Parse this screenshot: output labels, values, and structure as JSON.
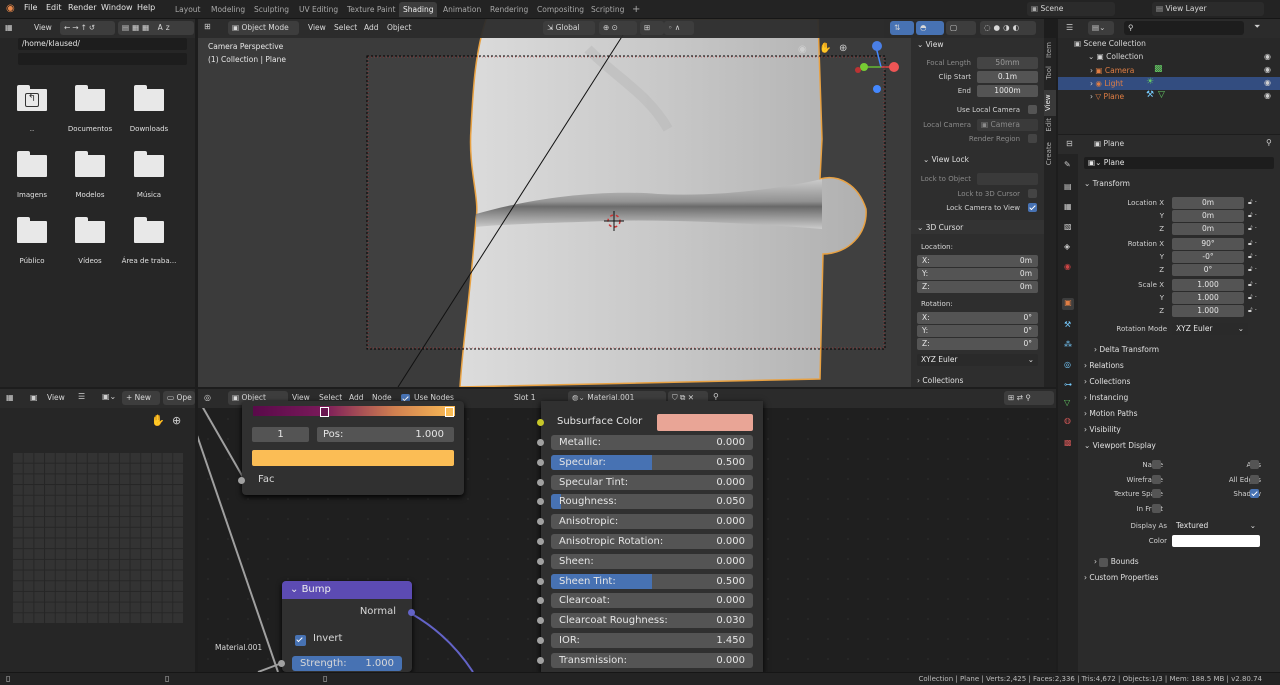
{
  "topbar": {
    "menus": [
      "File",
      "Edit",
      "Render",
      "Window",
      "Help"
    ],
    "tabs": [
      "Layout",
      "Modeling",
      "Sculpting",
      "UV Editing",
      "Texture Paint",
      "Shading",
      "Animation",
      "Rendering",
      "Compositing",
      "Scripting"
    ],
    "add_tab": "+",
    "scene": "Scene",
    "view_layer": "View Layer"
  },
  "file_browser": {
    "view_menu": "View",
    "path": "/home/klaused/",
    "folders": [
      {
        "label": "..",
        "icon": "parent-folder-icon"
      },
      {
        "label": "Documentos"
      },
      {
        "label": "Downloads"
      },
      {
        "label": "Imagens"
      },
      {
        "label": "Modelos"
      },
      {
        "label": "Música"
      },
      {
        "label": "Público"
      },
      {
        "label": "Vídeos"
      },
      {
        "label": "Área de traba..."
      }
    ]
  },
  "viewport": {
    "mode": "Object Mode",
    "menus": [
      "View",
      "Select",
      "Add",
      "Object"
    ],
    "orientation": "Global",
    "camera_label": "Camera Perspective",
    "collection_label": "(1) Collection | Plane"
  },
  "n_panel": {
    "tabs": [
      "Item",
      "Tool",
      "View",
      "Edit",
      "Create"
    ],
    "view_title": "View",
    "focal_length_label": "Focal Length",
    "focal_length": "50mm",
    "clip_start_label": "Clip Start",
    "clip_start": "0.1m",
    "end_label": "End",
    "clip_end": "1000m",
    "use_local_camera": "Use Local Camera",
    "local_camera_label": "Local Camera",
    "local_camera": "Camera",
    "render_region": "Render Region",
    "view_lock_title": "View Lock",
    "lock_to_object": "Lock to Object",
    "lock_to_3d_cursor": "Lock to 3D Cursor",
    "lock_camera_to_view": "Lock Camera to View",
    "cursor_title": "3D Cursor",
    "location_label": "Location:",
    "rotation_label": "Rotation:",
    "loc_x_label": "X:",
    "loc_x": "0m",
    "loc_y_label": "Y:",
    "loc_y": "0m",
    "loc_z_label": "Z:",
    "loc_z": "0m",
    "rot_x_label": "X:",
    "rot_x": "0°",
    "rot_y_label": "Y:",
    "rot_y": "0°",
    "rot_z_label": "Z:",
    "rot_z": "0°",
    "rot_mode": "XYZ Euler",
    "collections_title": "Collections"
  },
  "outliner": {
    "scene_collection": "Scene Collection",
    "collection": "Collection",
    "items": [
      {
        "label": "Camera",
        "color": "#e07e44"
      },
      {
        "label": "Light",
        "color": "#e07e44"
      },
      {
        "label": "Plane",
        "color": "#e07e44"
      }
    ]
  },
  "properties": {
    "object_name": "Plane",
    "data_name": "Plane",
    "transform_title": "Transform",
    "location_x_label": "Location X",
    "location_x": "0m",
    "location_y_label": "Y",
    "location_y": "0m",
    "location_z_label": "Z",
    "location_z": "0m",
    "rotation_x_label": "Rotation X",
    "rotation_x": "90°",
    "rotation_y_label": "Y",
    "rotation_y": "-0°",
    "rotation_z_label": "Z",
    "rotation_z": "0°",
    "scale_x_label": "Scale X",
    "scale_x": "1.000",
    "scale_y_label": "Y",
    "scale_y": "1.000",
    "scale_z_label": "Z",
    "scale_z": "1.000",
    "rotation_mode_label": "Rotation Mode",
    "rotation_mode": "XYZ Euler",
    "delta_transform": "Delta Transform",
    "relations": "Relations",
    "collections": "Collections",
    "instancing": "Instancing",
    "motion_paths": "Motion Paths",
    "visibility": "Visibility",
    "viewport_display": "Viewport Display",
    "vd_name": "Name",
    "vd_axis": "Axis",
    "vd_wireframe": "Wireframe",
    "vd_all_edges": "All Edges",
    "vd_texture_space": "Texture Space",
    "vd_shadow": "Shadow",
    "vd_in_front": "In Front",
    "display_as_label": "Display As",
    "display_as": "Textured",
    "color_label": "Color",
    "bounds": "Bounds",
    "custom_properties": "Custom Properties"
  },
  "image_editor": {
    "view_menu": "View",
    "new_button": "New",
    "open_button": "Ope"
  },
  "node_editor": {
    "editor_type": "Object",
    "menus": [
      "View",
      "Select",
      "Add",
      "Node"
    ],
    "use_nodes": "Use Nodes",
    "slot": "Slot 1",
    "material": "Material.001",
    "frame_label": "Material.001",
    "color_ramp": {
      "index": "1",
      "pos_label": "Pos:",
      "pos_value": "1.000",
      "fac_label": "Fac",
      "color": "#fbbd55"
    },
    "bump": {
      "title": "Bump",
      "normal_label": "Normal",
      "invert_label": "Invert",
      "strength_label": "Strength:",
      "strength_value": "1.000",
      "header_color": "#5c4bb3"
    },
    "bsdf": {
      "subsurface_color_label": "Subsurface Color",
      "subsurface_color": "#e9a596",
      "rows": [
        {
          "name": "Metallic:",
          "value": "0.000",
          "fill": 0
        },
        {
          "name": "Specular:",
          "value": "0.500",
          "fill": 0.5
        },
        {
          "name": "Specular Tint:",
          "value": "0.000",
          "fill": 0
        },
        {
          "name": "Roughness:",
          "value": "0.050",
          "fill": 0.05
        },
        {
          "name": "Anisotropic:",
          "value": "0.000",
          "fill": 0
        },
        {
          "name": "Anisotropic Rotation:",
          "value": "0.000",
          "fill": 0
        },
        {
          "name": "Sheen:",
          "value": "0.000",
          "fill": 0
        },
        {
          "name": "Sheen Tint:",
          "value": "0.500",
          "fill": 0.5
        },
        {
          "name": "Clearcoat:",
          "value": "0.000",
          "fill": 0
        },
        {
          "name": "Clearcoat Roughness:",
          "value": "0.030",
          "fill": 0.03
        },
        {
          "name": "IOR:",
          "value": "1.450",
          "fill": 0
        },
        {
          "name": "Transmission:",
          "value": "0.000",
          "fill": 0
        }
      ]
    }
  },
  "status_bar": {
    "text": "Collection | Plane | Verts:2,425 | Faces:2,336 | Tris:4,672 | Objects:1/3 | Mem: 188.5 MB | v2.80.74"
  }
}
